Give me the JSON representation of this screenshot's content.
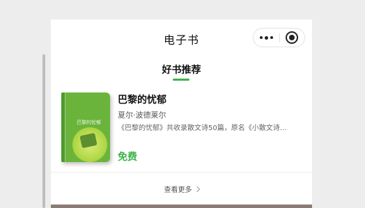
{
  "header": {
    "title": "电子书"
  },
  "capsule": {
    "more_icon": "more-dots-icon",
    "close_icon": "mini-program-close-icon"
  },
  "section": {
    "title": "好书推荐"
  },
  "book": {
    "cover_title": "巴黎的忧郁",
    "title": "巴黎的忧郁",
    "author": "夏尔·波德莱尔",
    "description": "《巴黎的忧郁》共收录散文诗50篇，原名《小散文诗…",
    "price": "免费"
  },
  "footer": {
    "view_more": "查看更多"
  },
  "colors": {
    "accent": "#3bb34a",
    "cover": "#6ab43c"
  }
}
